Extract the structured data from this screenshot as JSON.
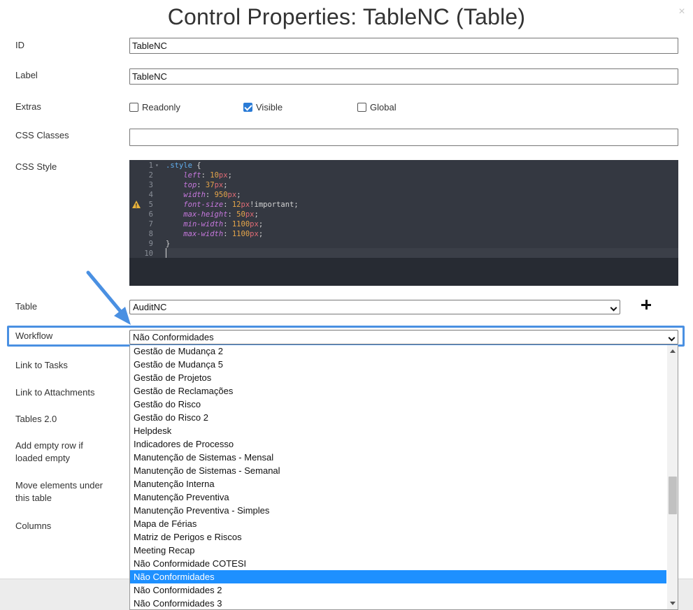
{
  "dialog": {
    "title": "Control Properties: TableNC (Table)",
    "close_glyph": "×"
  },
  "fields": {
    "id_label": "ID",
    "id_value": "TableNC",
    "label_label": "Label",
    "label_value": "TableNC",
    "extras_label": "Extras",
    "readonly_label": "Readonly",
    "readonly_checked": false,
    "visible_label": "Visible",
    "visible_checked": true,
    "global_label": "Global",
    "global_checked": false,
    "css_classes_label": "CSS Classes",
    "css_classes_value": "",
    "css_style_label": "CSS Style",
    "table_label": "Table",
    "table_value": "AuditNC",
    "workflow_label": "Workflow",
    "workflow_value": "Não Conformidades",
    "link_tasks_label": "Link to Tasks",
    "link_attachments_label": "Link to Attachments",
    "tables2_label": "Tables 2.0",
    "add_empty_row_label_1": "Add empty row if",
    "add_empty_row_label_2": "loaded empty",
    "move_elements_label_1": "Move elements under",
    "move_elements_label_2": "this table",
    "columns_label": "Columns"
  },
  "code_editor": {
    "warning_line": 5,
    "lines": [
      {
        "n": "1",
        "selector": ".style",
        "punc": " {"
      },
      {
        "n": "2",
        "prop": "left",
        "num": "10",
        "unit": "px"
      },
      {
        "n": "3",
        "prop": "top",
        "num": "37",
        "unit": "px"
      },
      {
        "n": "4",
        "prop": "width",
        "num": "950",
        "unit": "px"
      },
      {
        "n": "5",
        "prop": "font-size",
        "num": "12",
        "unit": "px",
        "suffix": "!important"
      },
      {
        "n": "6",
        "prop": "max-height",
        "num": "50",
        "unit": "px"
      },
      {
        "n": "7",
        "prop": "min-width",
        "num": "1100",
        "unit": "px"
      },
      {
        "n": "8",
        "prop": "max-width",
        "num": "1100",
        "unit": "px"
      },
      {
        "n": "9",
        "punc": "}"
      },
      {
        "n": "10"
      }
    ]
  },
  "workflow_options": [
    "Gestão de Mudança 2",
    "Gestão de Mudança 5",
    "Gestão de Projetos",
    "Gestão de Reclamações",
    "Gestão do Risco",
    "Gestão do Risco 2",
    "Helpdesk",
    "Indicadores de Processo",
    "Manutenção de Sistemas - Mensal",
    "Manutenção de Sistemas - Semanal",
    "Manutenção Interna",
    "Manutenção Preventiva",
    "Manutenção Preventiva - Simples",
    "Mapa de Férias",
    "Matriz de Perigos e Riscos",
    "Meeting Recap",
    "Não Conformidade COTESI",
    "Não Conformidades",
    "Não Conformidades 2",
    "Não Conformidades 3"
  ],
  "selected_option_index": 17,
  "colors": {
    "accent": "#4a90e2",
    "selected": "#1e90ff",
    "editor_bg": "#272b33"
  }
}
